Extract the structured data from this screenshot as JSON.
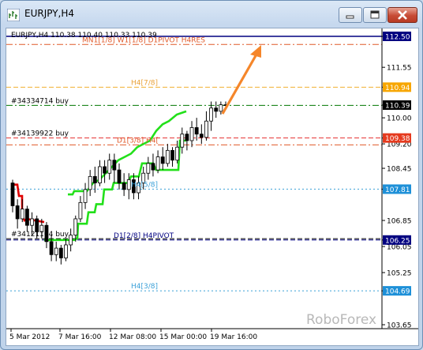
{
  "window": {
    "title": "EURJPY,H4",
    "buttons": {
      "minimize": "minimize",
      "maximize": "maximize",
      "close": "close"
    }
  },
  "chart_header": "EURJPY,H4  110.38 110.40 110.33 110.39",
  "levels": [
    {
      "id": "L1",
      "price": 112.5,
      "tag": "112.50",
      "color": "#000080",
      "style": "solid",
      "tag_bg": "#000080"
    },
    {
      "id": "L2",
      "price": 112.25,
      "label": "MN1[1/8] W1[1/8] D1PIVOT H4RES",
      "color": "#e05a2a",
      "style": "dashdot",
      "label_color": "#e05a2a"
    },
    {
      "id": "L3",
      "price": 110.94,
      "label": "H4[7/8]",
      "tag": "110.94",
      "color": "#f0b030",
      "style": "dashed",
      "tag_bg": "#f7a600",
      "label_color": "#e9a23a"
    },
    {
      "id": "L4",
      "price": 110.39,
      "tag": "110.39",
      "color": "#000000",
      "style": "none",
      "tag_bg": "#000000"
    },
    {
      "id": "L5",
      "price": 110.38,
      "label": "#34334714 buy",
      "color": "#007700",
      "style": "dashdot",
      "label_color": "#000000"
    },
    {
      "id": "L6",
      "price": 109.38,
      "label": "#34139922 buy",
      "tag": "109.38",
      "color": "#e53030",
      "style": "dashed",
      "tag_bg": "#e53a1e",
      "label_color": "#000000"
    },
    {
      "id": "L7",
      "price": 109.17,
      "label": "D1[3/8] H4[",
      "color": "#e05a2a",
      "style": "dashdot",
      "label_color": "#e05a2a"
    },
    {
      "id": "L8",
      "price": 107.81,
      "label": "H4[5/8]",
      "tag": "107.81",
      "color": "#3aa0d8",
      "style": "dotted",
      "tag_bg": "#1e90d8",
      "label_color": "#3aa0d8"
    },
    {
      "id": "L9",
      "price": 106.29,
      "label": "#34121104 buy",
      "color": "#000000",
      "style": "dashed",
      "label_color": "#000000"
    },
    {
      "id": "L10",
      "price": 106.25,
      "label": "D1[2/8] H4PIVOT",
      "tag": "106.25",
      "color": "#000080",
      "style": "dashed",
      "tag_bg": "#000080",
      "label_color": "#000080"
    },
    {
      "id": "L11",
      "price": 104.69,
      "label": "H4[3/8]",
      "tag": "104.69",
      "color": "#3aa0d8",
      "style": "dotted",
      "tag_bg": "#1e90d8",
      "label_color": "#3aa0d8"
    }
  ],
  "y_axis": {
    "ticks": [
      "112.50",
      "111.55",
      "110.94",
      "110.39",
      "110.00",
      "109.38",
      "109.20",
      "108.45",
      "107.81",
      "106.85",
      "106.25",
      "106.05",
      "105.25",
      "104.69",
      "103.65"
    ]
  },
  "x_axis": {
    "ticks": [
      "5 Mar 2012",
      "7 Mar 16:00",
      "12 Mar 08:00",
      "15 Mar 00:00",
      "19 Mar 16:00"
    ]
  },
  "watermark": "RoboForex",
  "colors": {
    "candle": "#000000",
    "trail_red": "#e00000",
    "trail_green": "#22e01a",
    "arrow": "#f5862a"
  },
  "trail_red": [
    [
      0,
      107.95
    ],
    [
      8,
      107.95
    ],
    [
      10,
      107.6
    ],
    [
      14,
      107.6
    ],
    [
      14,
      107.0
    ],
    [
      17,
      106.85
    ],
    [
      20,
      106.9
    ],
    [
      30,
      106.85
    ],
    [
      42,
      106.8
    ]
  ],
  "trail_green": [
    [
      42,
      106.25
    ],
    [
      80,
      106.25
    ],
    [
      84,
      106.3
    ],
    [
      85,
      106.75
    ],
    [
      96,
      106.75
    ],
    [
      98,
      107.1
    ],
    [
      106,
      107.1
    ],
    [
      108,
      107.35
    ],
    [
      116,
      107.35
    ],
    [
      118,
      107.8
    ],
    [
      128,
      107.8
    ],
    [
      130,
      108.0
    ],
    [
      148,
      108.0
    ],
    [
      152,
      108.2
    ],
    [
      162,
      108.2
    ],
    [
      166,
      108.6
    ],
    [
      180,
      108.6
    ],
    [
      184,
      108.4
    ],
    [
      212,
      108.4
    ],
    [
      214,
      109.3
    ],
    [
      222,
      109.3
    ]
  ],
  "trail_green_upper": [
    [
      72,
      107.65
    ],
    [
      78,
      107.65
    ],
    [
      80,
      107.75
    ],
    [
      96,
      107.75
    ],
    [
      104,
      108.0
    ],
    [
      112,
      108.1
    ],
    [
      120,
      108.3
    ],
    [
      128,
      108.5
    ],
    [
      136,
      108.7
    ],
    [
      144,
      108.8
    ],
    [
      152,
      108.9
    ],
    [
      160,
      109.1
    ],
    [
      168,
      109.2
    ],
    [
      176,
      109.3
    ],
    [
      184,
      109.6
    ],
    [
      192,
      109.8
    ],
    [
      200,
      109.9
    ],
    [
      210,
      110.1
    ],
    [
      222,
      110.2
    ]
  ],
  "candles": [
    [
      108.0,
      107.3,
      107.1,
      108.1
    ],
    [
      107.3,
      106.9,
      106.6,
      107.5
    ],
    [
      106.9,
      107.2,
      106.8,
      107.5
    ],
    [
      107.2,
      106.7,
      106.5,
      107.3
    ],
    [
      106.7,
      106.9,
      106.4,
      107.1
    ],
    [
      106.9,
      106.5,
      106.3,
      107.0
    ],
    [
      106.5,
      106.7,
      106.3,
      106.9
    ],
    [
      106.7,
      106.2,
      106.0,
      106.8
    ],
    [
      106.2,
      105.8,
      105.6,
      106.4
    ],
    [
      105.8,
      106.0,
      105.6,
      106.2
    ],
    [
      106.0,
      105.7,
      105.5,
      106.1
    ],
    [
      105.7,
      106.1,
      105.6,
      106.3
    ],
    [
      106.1,
      106.4,
      105.9,
      106.6
    ],
    [
      106.4,
      106.9,
      106.2,
      107.0
    ],
    [
      106.9,
      107.4,
      106.8,
      107.6
    ],
    [
      107.4,
      107.8,
      107.2,
      108.0
    ],
    [
      107.8,
      108.2,
      107.6,
      108.4
    ],
    [
      108.2,
      108.0,
      107.7,
      108.5
    ],
    [
      108.0,
      108.5,
      107.9,
      108.7
    ],
    [
      108.5,
      108.3,
      108.0,
      108.7
    ],
    [
      108.3,
      108.7,
      108.1,
      108.9
    ],
    [
      108.7,
      108.4,
      108.0,
      108.9
    ],
    [
      108.4,
      108.0,
      107.8,
      108.6
    ],
    [
      108.0,
      107.8,
      107.6,
      108.3
    ],
    [
      107.8,
      108.1,
      107.5,
      108.3
    ],
    [
      108.1,
      107.7,
      107.5,
      108.3
    ],
    [
      107.7,
      108.0,
      107.5,
      108.2
    ],
    [
      108.0,
      108.3,
      107.8,
      108.5
    ],
    [
      108.3,
      108.6,
      108.1,
      108.8
    ],
    [
      108.6,
      108.4,
      108.2,
      108.9
    ],
    [
      108.4,
      108.8,
      108.3,
      109.0
    ],
    [
      108.8,
      108.6,
      108.4,
      109.1
    ],
    [
      108.6,
      109.0,
      108.5,
      109.2
    ],
    [
      109.0,
      108.7,
      108.5,
      109.1
    ],
    [
      108.7,
      109.1,
      108.6,
      109.3
    ],
    [
      109.1,
      109.5,
      108.9,
      109.7
    ],
    [
      109.5,
      109.3,
      109.0,
      109.6
    ],
    [
      109.3,
      109.7,
      109.1,
      109.9
    ],
    [
      109.7,
      109.5,
      109.3,
      110.0
    ],
    [
      109.5,
      109.4,
      109.2,
      109.8
    ],
    [
      109.4,
      109.9,
      109.3,
      110.2
    ],
    [
      109.9,
      110.3,
      109.6,
      110.5
    ],
    [
      110.3,
      110.2,
      110.0,
      110.5
    ],
    [
      110.2,
      110.4,
      110.1,
      110.5
    ],
    [
      110.4,
      110.39,
      110.3,
      110.5
    ]
  ]
}
